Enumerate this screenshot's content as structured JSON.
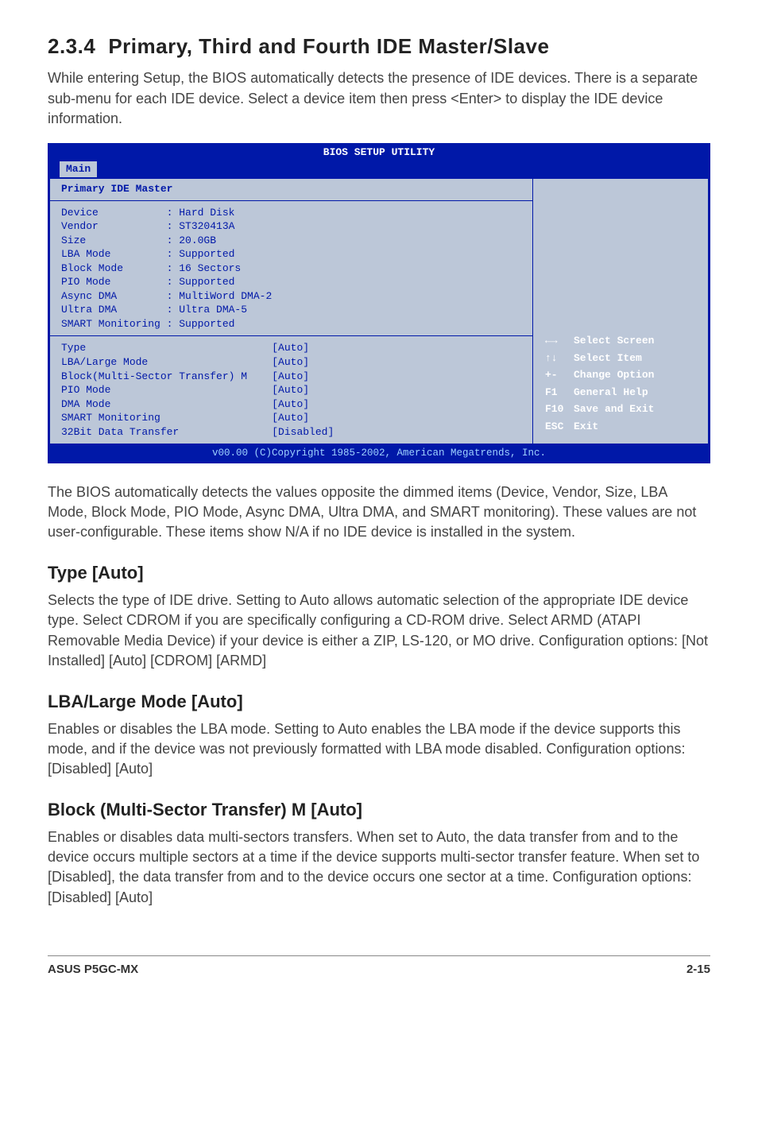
{
  "section": {
    "number": "2.3.4",
    "title": "Primary, Third and Fourth IDE Master/Slave",
    "intro": "While entering Setup, the BIOS automatically detects the presence of IDE devices. There is a separate sub-menu for each IDE device. Select a device item then press <Enter> to display the IDE device information."
  },
  "bios": {
    "utility_title": "BIOS SETUP UTILITY",
    "tab": "Main",
    "panel_title": "Primary IDE Master",
    "info": [
      {
        "label": "Device",
        "value": ": Hard Disk"
      },
      {
        "label": "Vendor",
        "value": ": ST320413A"
      },
      {
        "label": "Size",
        "value": ": 20.0GB"
      },
      {
        "label": "LBA Mode",
        "value": ": Supported"
      },
      {
        "label": "Block Mode",
        "value": ": 16 Sectors"
      },
      {
        "label": "PIO Mode",
        "value": ": Supported"
      },
      {
        "label": "Async DMA",
        "value": ": MultiWord DMA-2"
      },
      {
        "label": "Ultra DMA",
        "value": ": Ultra DMA-5"
      },
      {
        "label": "SMART Monitoring",
        "value": ": Supported"
      }
    ],
    "options": [
      {
        "label": "Type",
        "value": "[Auto]"
      },
      {
        "label": "LBA/Large Mode",
        "value": "[Auto]"
      },
      {
        "label": "Block(Multi-Sector Transfer) M",
        "value": "[Auto]"
      },
      {
        "label": "PIO Mode",
        "value": "[Auto]"
      },
      {
        "label": "DMA Mode",
        "value": "[Auto]"
      },
      {
        "label": "SMART Monitoring",
        "value": "[Auto]"
      },
      {
        "label": "32Bit Data Transfer",
        "value": "[Disabled]"
      }
    ],
    "help": [
      {
        "key": "←→",
        "label": "Select Screen"
      },
      {
        "key": "↑↓",
        "label": "Select Item"
      },
      {
        "key": "+-",
        "label": "Change Option"
      },
      {
        "key": "F1",
        "label": "General Help"
      },
      {
        "key": "F10",
        "label": "Save and Exit"
      },
      {
        "key": "ESC",
        "label": "Exit"
      }
    ],
    "footer": "v00.00 (C)Copyright 1985-2002, American Megatrends, Inc."
  },
  "after_bios": "The BIOS automatically detects the values opposite the dimmed items (Device, Vendor, Size, LBA Mode, Block Mode, PIO Mode, Async DMA, Ultra DMA, and SMART monitoring). These values are not user-configurable. These items show N/A if no IDE device is installed in the system.",
  "type": {
    "heading": "Type [Auto]",
    "body": "Selects the type of IDE drive. Setting to Auto allows automatic selection of the appropriate IDE device type. Select CDROM if you are specifically configuring a CD-ROM drive. Select ARMD (ATAPI Removable Media Device) if your device is either a ZIP, LS-120, or MO drive. Configuration options: [Not Installed] [Auto] [CDROM] [ARMD]"
  },
  "lba": {
    "heading": "LBA/Large Mode [Auto]",
    "body": "Enables or disables the LBA mode. Setting to Auto enables the LBA mode if the device supports this mode, and if the device was not previously formatted with LBA mode disabled. Configuration options: [Disabled] [Auto]"
  },
  "block": {
    "heading": "Block (Multi-Sector Transfer) M [Auto]",
    "body": "Enables or disables data multi-sectors transfers. When set to Auto, the data transfer from and to the device occurs multiple sectors at a time if the device supports multi-sector transfer feature. When set to [Disabled], the data transfer from and to the device occurs one sector at a time. Configuration options: [Disabled] [Auto]"
  },
  "footer": {
    "left": "ASUS P5GC-MX",
    "right": "2-15"
  }
}
